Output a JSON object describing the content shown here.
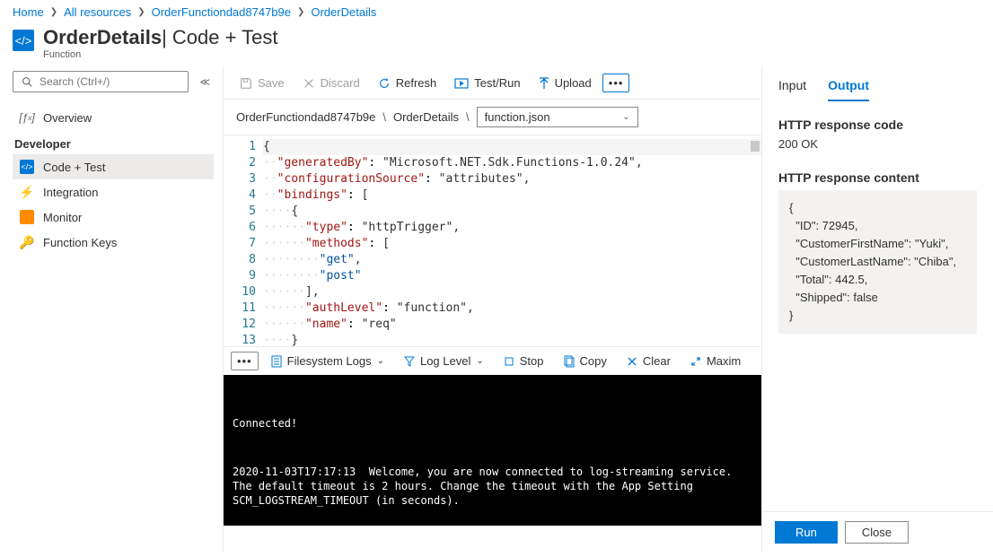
{
  "breadcrumb": {
    "home": "Home",
    "all_resources": "All resources",
    "function_app": "OrderFunctiondad8747b9e",
    "function": "OrderDetails"
  },
  "header": {
    "title_bold": "OrderDetails",
    "title_sep": " | ",
    "title_light": "Code + Test",
    "subtitle": "Function"
  },
  "sidebar": {
    "search_placeholder": "Search (Ctrl+/)",
    "overview": "Overview",
    "section_developer": "Developer",
    "items": [
      {
        "label": "Code + Test"
      },
      {
        "label": "Integration"
      },
      {
        "label": "Monitor"
      },
      {
        "label": "Function Keys"
      }
    ]
  },
  "toolbar": {
    "save": "Save",
    "discard": "Discard",
    "refresh": "Refresh",
    "test_run": "Test/Run",
    "upload": "Upload"
  },
  "pathbar": {
    "seg1": "OrderFunctiondad8747b9e",
    "seg2": "OrderDetails",
    "file": "function.json"
  },
  "code": {
    "lines": [
      "{",
      "  \"generatedBy\": \"Microsoft.NET.Sdk.Functions-1.0.24\",",
      "  \"configurationSource\": \"attributes\",",
      "  \"bindings\": [",
      "    {",
      "      \"type\": \"httpTrigger\",",
      "      \"methods\": [",
      "        \"get\",",
      "        \"post\"",
      "      ],",
      "      \"authLevel\": \"function\",",
      "      \"name\": \"req\"",
      "    }",
      "  ],"
    ]
  },
  "logbar": {
    "filesystem_logs": "Filesystem Logs",
    "log_level": "Log Level",
    "stop": "Stop",
    "copy": "Copy",
    "clear": "Clear",
    "maximize": "Maxim"
  },
  "console": {
    "connected": "Connected!",
    "body": "2020-11-03T17:17:13  Welcome, you are now connected to log-streaming service. The default timeout is 2 hours. Change the timeout with the App Setting SCM_LOGSTREAM_TIMEOUT (in seconds)."
  },
  "right": {
    "tab_input": "Input",
    "tab_output": "Output",
    "resp_code_h": "HTTP response code",
    "resp_code_v": "200 OK",
    "resp_content_h": "HTTP response content",
    "resp_body": "{\n  \"ID\": 72945,\n  \"CustomerFirstName\": \"Yuki\",\n  \"CustomerLastName\": \"Chiba\",\n  \"Total\": 442.5,\n  \"Shipped\": false\n}",
    "run": "Run",
    "close": "Close"
  }
}
